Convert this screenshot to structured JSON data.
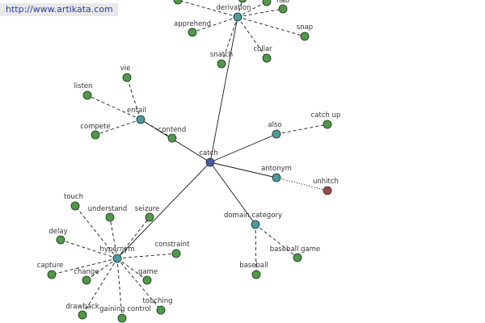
{
  "site": {
    "url": "http://www.artikata.com"
  },
  "colors": {
    "root": "#4a5aa8",
    "relation": "#4a9aa0",
    "word": "#4e9a48",
    "antonym_word": "#a04848",
    "background": "#ffffff",
    "url_text": "#2c3f9c",
    "url_background": "#e9e9e9"
  },
  "graph": {
    "root": "catch",
    "relations": [
      {
        "id": "derivation",
        "label": "derivation",
        "words": [
          "nab",
          "apprehend",
          "snap",
          "snatch",
          "collar",
          "",
          "",
          ""
        ]
      },
      {
        "id": "entail",
        "label": "entail",
        "words": [
          "vie",
          "listen",
          "compete",
          "contend"
        ]
      },
      {
        "id": "also",
        "label": "also",
        "words": [
          "catch up"
        ]
      },
      {
        "id": "antonym",
        "label": "antonym",
        "words": [
          "unhitch"
        ]
      },
      {
        "id": "domain-category",
        "label": "domain category",
        "words": [
          "baseball game",
          "baseball"
        ]
      },
      {
        "id": "hypernym",
        "label": "hypernym",
        "words": [
          "touch",
          "understand",
          "seizure",
          "delay",
          "constraint",
          "capture",
          "change",
          "game",
          "drawback",
          "gaining control",
          "touching"
        ]
      }
    ]
  }
}
